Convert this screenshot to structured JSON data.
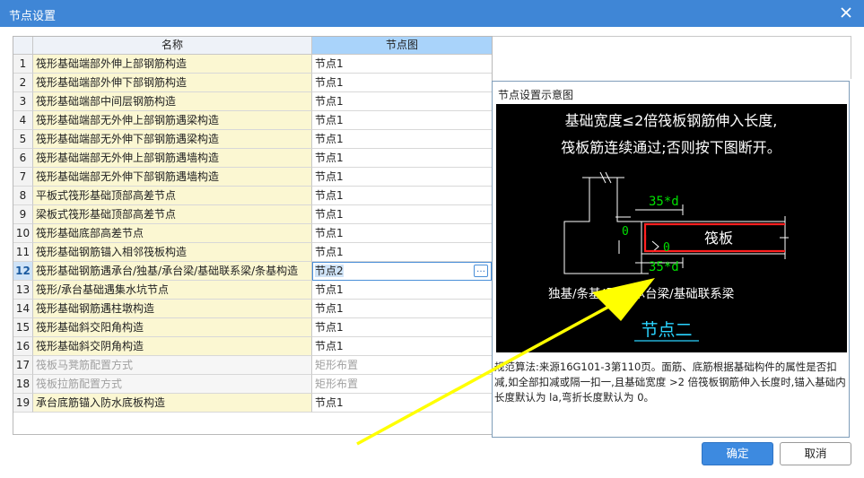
{
  "window": {
    "title": "节点设置"
  },
  "grid": {
    "col_name": "名称",
    "col_node": "节点图",
    "rows": [
      {
        "no": "1",
        "name": "筏形基础端部外伸上部钢筋构造",
        "node": "节点1"
      },
      {
        "no": "2",
        "name": "筏形基础端部外伸下部钢筋构造",
        "node": "节点1"
      },
      {
        "no": "3",
        "name": "筏形基础端部中间层钢筋构造",
        "node": "节点1"
      },
      {
        "no": "4",
        "name": "筏形基础端部无外伸上部钢筋遇梁构造",
        "node": "节点1"
      },
      {
        "no": "5",
        "name": "筏形基础端部无外伸下部钢筋遇梁构造",
        "node": "节点1"
      },
      {
        "no": "6",
        "name": "筏形基础端部无外伸上部钢筋遇墙构造",
        "node": "节点1"
      },
      {
        "no": "7",
        "name": "筏形基础端部无外伸下部钢筋遇墙构造",
        "node": "节点1"
      },
      {
        "no": "8",
        "name": "平板式筏形基础顶部高差节点",
        "node": "节点1"
      },
      {
        "no": "9",
        "name": "梁板式筏形基础顶部高差节点",
        "node": "节点1"
      },
      {
        "no": "10",
        "name": "筏形基础底部高差节点",
        "node": "节点1"
      },
      {
        "no": "11",
        "name": "筏形基础钢筋锚入相邻筏板构造",
        "node": "节点1"
      },
      {
        "no": "12",
        "name": "筏形基础钢筋遇承台/独基/承台梁/基础联系梁/条基构造",
        "node": "节点2"
      },
      {
        "no": "13",
        "name": "筏形/承台基础遇集水坑节点",
        "node": "节点1"
      },
      {
        "no": "14",
        "name": "筏形基础钢筋遇柱墩构造",
        "node": "节点1"
      },
      {
        "no": "15",
        "name": "筏形基础斜交阳角构造",
        "node": "节点1"
      },
      {
        "no": "16",
        "name": "筏形基础斜交阴角构造",
        "node": "节点1"
      },
      {
        "no": "17",
        "name": "筏板马凳筋配置方式",
        "node": "矩形布置"
      },
      {
        "no": "18",
        "name": "筏板拉筋配置方式",
        "node": "矩形布置"
      },
      {
        "no": "19",
        "name": "承台底筋锚入防水底板构造",
        "node": "节点1"
      }
    ]
  },
  "preview": {
    "label": "节点设置示意图",
    "cad_line1": "基础宽度≤2倍筏板钢筋伸入长度,",
    "cad_line2": "筏板筋连续通过;否则按下图断开。",
    "dim_top": "35*d",
    "dim_bottom": "35*d",
    "zero_left": "0",
    "zero_right": "0",
    "slab_label": "筏板",
    "member_label": "独基/条基/承台/承台梁/基础联系梁",
    "node_title": "节点二",
    "description": "规范算法:来源16G101-3第110页。面筋、底筋根据基础构件的属性是否扣减,如全部扣减或隔一扣一,且基础宽度 >2 倍筏板钢筋伸入长度时,锚入基础内长度默认为 la,弯折长度默认为 0。"
  },
  "buttons": {
    "ok": "确定",
    "cancel": "取消"
  },
  "colors": {
    "titlebar": "#3f86d6",
    "header_active": "#a9d3fa",
    "name_cell": "#fbf7d2",
    "cad_green": "#00e000",
    "cad_red": "#ff2020",
    "cad_cyan": "#2ad4ff",
    "arrow": "#ffff00"
  },
  "icons": {
    "close": "close-icon",
    "more": "ellipsis-icon"
  }
}
